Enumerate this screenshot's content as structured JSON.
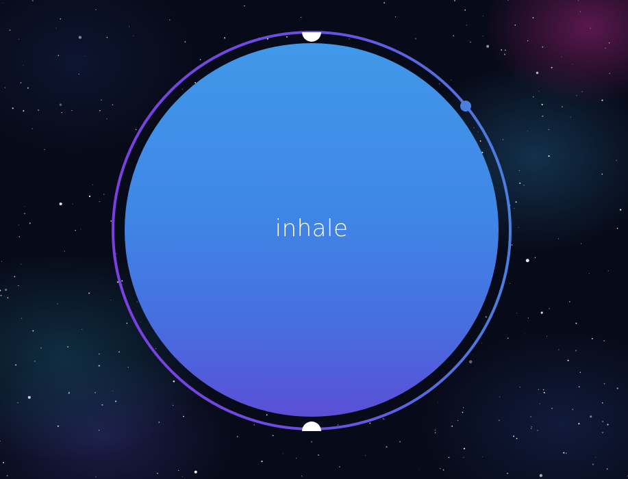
{
  "breath": {
    "phase_label": "inhale"
  },
  "colors": {
    "orb_top": "#4198e9",
    "orb_bottom": "#5a4fd6",
    "ring_purple": "#7b3fe0",
    "ring_blue": "#4a7fe0",
    "marker": "#ffffff"
  },
  "icons": {
    "top_marker": "half-circle-marker",
    "bottom_marker": "half-circle-marker",
    "progress_head": "dot-handle"
  }
}
